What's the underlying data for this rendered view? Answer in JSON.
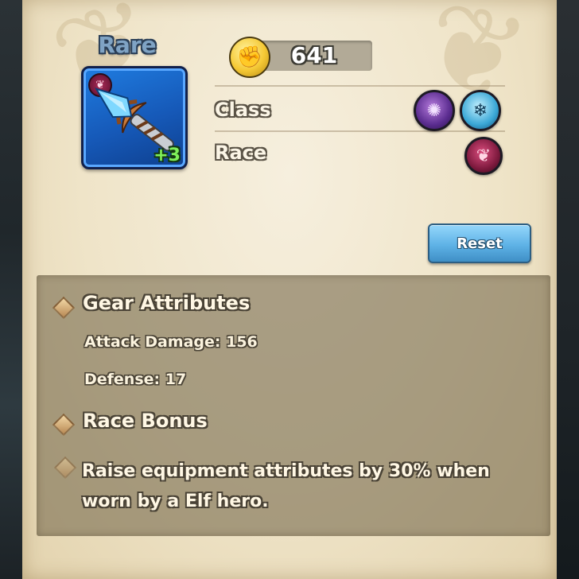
{
  "item": {
    "rarity": "Rare",
    "enhance_level": "+3",
    "race_icon": "elf-wing-icon",
    "frame_color": "#1f6fd6"
  },
  "power": {
    "icon": "fist-icon",
    "value": "641"
  },
  "attributes": {
    "class_label": "Class",
    "class_icons": [
      "dark-class-icon",
      "ice-class-icon"
    ],
    "race_label": "Race",
    "race_icons": [
      "elf-race-icon"
    ]
  },
  "reset": {
    "label": "Reset"
  },
  "gear_attributes": {
    "title": "Gear Attributes",
    "stats": [
      "Attack Damage: 156",
      "Defense: 17"
    ]
  },
  "race_bonus": {
    "title": "Race Bonus",
    "text": "Raise equipment attributes by 30% when worn by a Elf hero."
  },
  "colors": {
    "parchment": "#efe4c8",
    "rare_blue": "#7fa3c4",
    "button_blue": "#5eb2e6",
    "enhance_green": "#7ff05a"
  }
}
